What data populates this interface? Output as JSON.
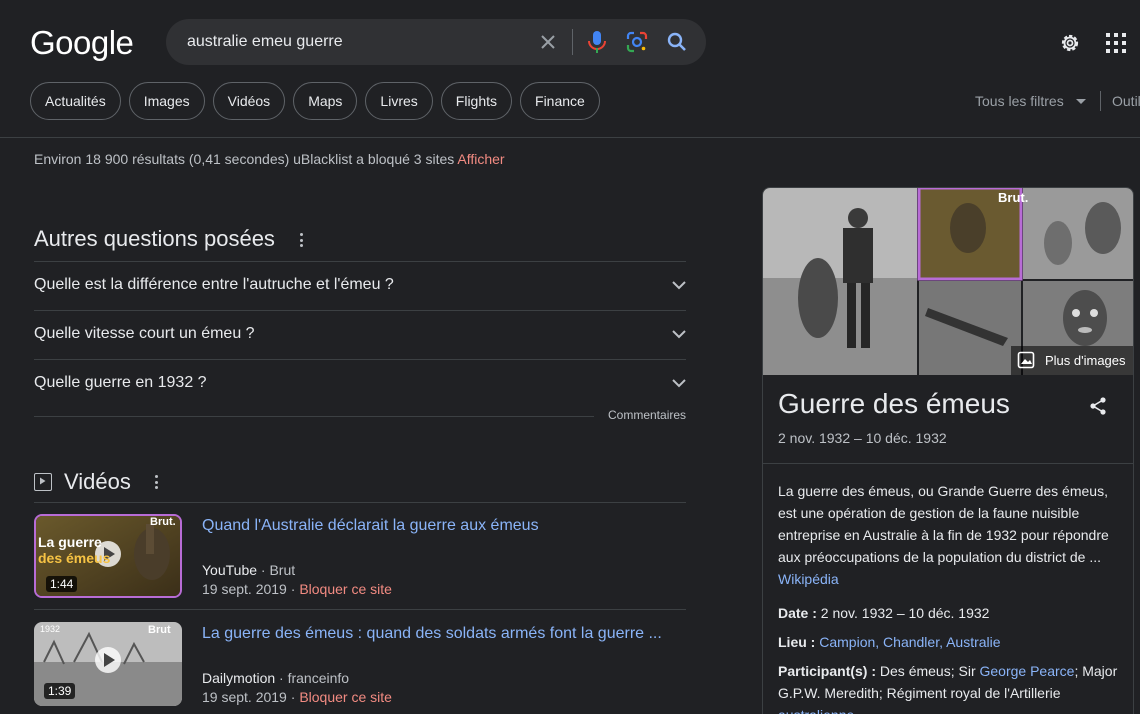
{
  "header": {
    "logo": "Google",
    "query": "australie emeu guerre"
  },
  "chips": [
    "Actualités",
    "Images",
    "Vidéos",
    "Maps",
    "Livres",
    "Flights",
    "Finance"
  ],
  "filters": {
    "all_filters": "Tous les filtres",
    "tools": "Outils"
  },
  "stats": {
    "text": "Environ 18 900 résultats (0,41 secondes) uBlacklist a bloqué 3 sites",
    "action": "Afficher"
  },
  "paa": {
    "title": "Autres questions posées",
    "questions": [
      "Quelle est la différence entre l'autruche et l'émeu ?",
      "Quelle vitesse court un émeu ?",
      "Quelle guerre en 1932 ?"
    ],
    "feedback": "Commentaires"
  },
  "videos": {
    "title": "Vidéos",
    "items": [
      {
        "title": "Quand l'Australie déclarait la guerre aux émeus",
        "source": "YouTube",
        "channel": "Brut",
        "date": "19 sept. 2019",
        "block": "Bloquer ce site",
        "duration": "1:44",
        "thumb_text_1": "La guerre",
        "thumb_text_2": "des émeus",
        "thumb_brand": "Brut."
      },
      {
        "title": "La guerre des émeus : quand des soldats armés font la guerre ...",
        "source": "Dailymotion",
        "channel": "franceinfo",
        "date": "19 sept. 2019",
        "block": "Bloquer ce site",
        "duration": "1:39",
        "thumb_text_1": "1932",
        "thumb_text_2": "",
        "thumb_brand": "Brut"
      }
    ]
  },
  "panel": {
    "more_images": "Plus d'images",
    "brand_tag": "Brut.",
    "title": "Guerre des émeus",
    "dates": "2 nov. 1932 – 10 déc. 1932",
    "description": "La guerre des émeus, ou Grande Guerre des émeus, est une opération de gestion de la faune nuisible entreprise en Australie à la fin de 1932 pour répondre aux préoccupations de la population du district de ...",
    "source": "Wikipédia",
    "date_label": "Date :",
    "date_value": "2 nov. 1932 – 10 déc. 1932",
    "place_label": "Lieu :",
    "place_value": "Campion, Chandler, Australie",
    "participants_label": "Participant(s) :",
    "participants_1": "Des émeus; Sir",
    "participants_link1": "George Pearce",
    "participants_2": "; Major G.P.W. Meredith; Régiment royal de l'Artillerie",
    "participants_link2": "australienne"
  },
  "colors": {
    "background": "#202124",
    "link": "#8ab4f8",
    "danger": "#f28b82",
    "muted": "#bdc1c6"
  }
}
